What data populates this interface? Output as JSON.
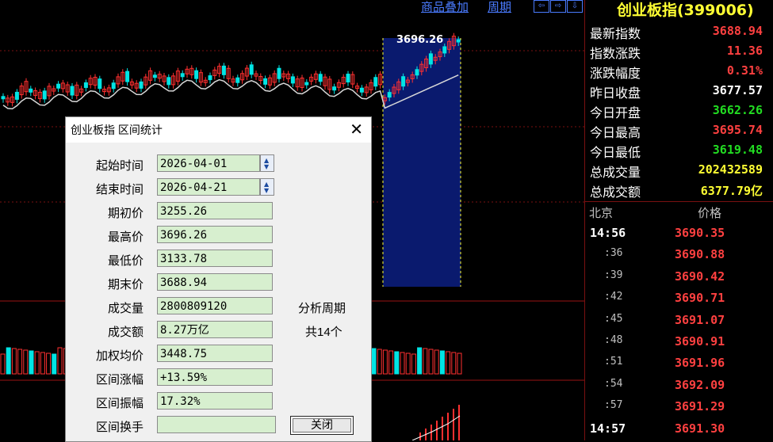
{
  "toolbar": {
    "overlay_label": "商品叠加",
    "period_label": "周期",
    "nav_buttons": [
      "⇦",
      "⇨",
      "⇩"
    ]
  },
  "chart": {
    "peak_label": "3696.26"
  },
  "quote_panel": {
    "title": "创业板指(399006)",
    "rows": [
      {
        "label": "最新指数",
        "value": "3688.94",
        "color": "#ff4040"
      },
      {
        "label": "指数涨跌",
        "value": "11.36",
        "color": "#ff4040"
      },
      {
        "label": "涨跌幅度",
        "value": "0.31%",
        "color": "#ff4040"
      },
      {
        "label": "昨日收盘",
        "value": "3677.57",
        "color": "#ffffff"
      },
      {
        "label": "今日开盘",
        "value": "3662.26",
        "color": "#22dd22"
      },
      {
        "label": "今日最高",
        "value": "3695.74",
        "color": "#ff4040"
      },
      {
        "label": "今日最低",
        "value": "3619.48",
        "color": "#22dd22"
      },
      {
        "label": "总成交量",
        "value": "202432589",
        "color": "#ffff33"
      },
      {
        "label": "总成交额",
        "value": "6377.79亿",
        "color": "#ffff33"
      }
    ],
    "ticks_header": {
      "time": "北京",
      "price": "价格"
    },
    "ticks": [
      {
        "time": "14:56",
        "price": "3690.35"
      },
      {
        "time": ":36",
        "price": "3690.88"
      },
      {
        "time": ":39",
        "price": "3690.42"
      },
      {
        "time": ":42",
        "price": "3690.71"
      },
      {
        "time": ":45",
        "price": "3691.07"
      },
      {
        "time": ":48",
        "price": "3690.91"
      },
      {
        "time": ":51",
        "price": "3691.96"
      },
      {
        "time": ":54",
        "price": "3692.09"
      },
      {
        "time": ":57",
        "price": "3691.29"
      },
      {
        "time": "14:57",
        "price": "3691.30"
      }
    ]
  },
  "dialog": {
    "title": "创业板指 区间统计",
    "close_glyph": "✕",
    "start_label": "起始时间",
    "start_value": "2026-04-01",
    "end_label": "结束时间",
    "end_value": "2026-04-21",
    "fields": [
      {
        "label": "期初价",
        "value": "3255.26"
      },
      {
        "label": "最高价",
        "value": "3696.26"
      },
      {
        "label": "最低价",
        "value": "3133.78"
      },
      {
        "label": "期末价",
        "value": "3688.94"
      },
      {
        "label": "成交量",
        "value": "2800809120"
      },
      {
        "label": "成交额",
        "value": "8.27万亿"
      },
      {
        "label": "加权均价",
        "value": "3448.75"
      },
      {
        "label": "区间涨幅",
        "value": "+13.59%"
      },
      {
        "label": "区间振幅",
        "value": "17.32%"
      },
      {
        "label": "区间换手",
        "value": ""
      }
    ],
    "period_label": "分析周期",
    "period_count": "共14个",
    "close_button": "关闭"
  },
  "colors": {
    "up": "#ff3030",
    "down": "#00e5e5",
    "selection": "#0a1a6e",
    "ma": "#d8d8d8"
  }
}
